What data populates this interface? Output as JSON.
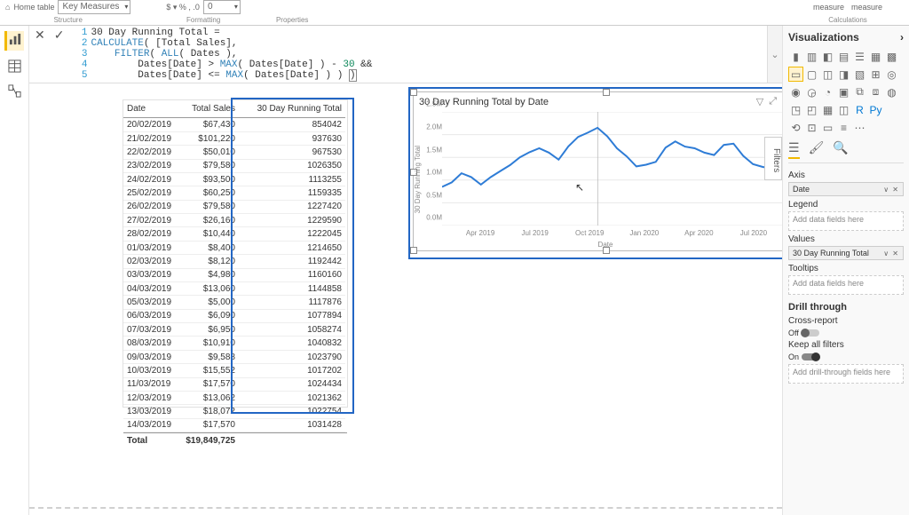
{
  "ribbon": {
    "home_table_label": "Home table",
    "home_table_value": "Key Measures",
    "structure_label": "Structure",
    "format_symbols": "$ ▾  %  ,  .0",
    "decimal_value": "0",
    "formatting_label": "Formatting",
    "properties_label": "Properties",
    "measure_btn1": "",
    "measure_btn2": "measure",
    "measure_btn3": "measure",
    "calculations_label": "Calculations"
  },
  "formula": {
    "l1": "30 Day Running Total =",
    "l2": "CALCULATE( [Total Sales],",
    "l3": "    FILTER( ALL( Dates ),",
    "l4": "        Dates[Date] > MAX( Dates[Date] ) - 30 &&",
    "l5": "        Dates[Date] <= MAX( Dates[Date] ) ) )"
  },
  "table": {
    "headers": [
      "Date",
      "Total Sales",
      "30 Day Running Total"
    ],
    "rows": [
      [
        "20/02/2019",
        "$67,430",
        "854042"
      ],
      [
        "21/02/2019",
        "$101,220",
        "937630"
      ],
      [
        "22/02/2019",
        "$50,010",
        "967530"
      ],
      [
        "23/02/2019",
        "$79,580",
        "1026350"
      ],
      [
        "24/02/2019",
        "$93,500",
        "1113255"
      ],
      [
        "25/02/2019",
        "$60,250",
        "1159335"
      ],
      [
        "26/02/2019",
        "$79,580",
        "1227420"
      ],
      [
        "27/02/2019",
        "$26,160",
        "1229590"
      ],
      [
        "28/02/2019",
        "$10,440",
        "1222045"
      ],
      [
        "01/03/2019",
        "$8,400",
        "1214650"
      ],
      [
        "02/03/2019",
        "$8,120",
        "1192442"
      ],
      [
        "03/03/2019",
        "$4,980",
        "1160160"
      ],
      [
        "04/03/2019",
        "$13,060",
        "1144858"
      ],
      [
        "05/03/2019",
        "$5,000",
        "1117876"
      ],
      [
        "06/03/2019",
        "$6,090",
        "1077894"
      ],
      [
        "07/03/2019",
        "$6,950",
        "1058274"
      ],
      [
        "08/03/2019",
        "$10,910",
        "1040832"
      ],
      [
        "09/03/2019",
        "$9,588",
        "1023790"
      ],
      [
        "10/03/2019",
        "$15,552",
        "1017202"
      ],
      [
        "11/03/2019",
        "$17,570",
        "1024434"
      ],
      [
        "12/03/2019",
        "$13,062",
        "1021362"
      ],
      [
        "13/03/2019",
        "$18,072",
        "1022754"
      ],
      [
        "14/03/2019",
        "$17,570",
        "1031428"
      ]
    ],
    "total_label": "Total",
    "total_value": "$19,849,725"
  },
  "chart": {
    "title": "30 Day Running Total by Date",
    "y_label": "30 Day Running Total",
    "x_label": "Date",
    "y_ticks": [
      "0.0M",
      "0.5M",
      "1.0M",
      "1.5M",
      "2.0M",
      "2.5M"
    ],
    "x_ticks": [
      "Apr 2019",
      "Jul 2019",
      "Oct 2019",
      "Jan 2020",
      "Apr 2020",
      "Jul 2020"
    ]
  },
  "chart_data": {
    "type": "line",
    "xlabel": "Date",
    "ylabel": "30 Day Running Total",
    "ylim": [
      0,
      2500000
    ],
    "x": [
      "Feb 2019",
      "Mar 2019",
      "Apr 2019",
      "May 2019",
      "Jun 2019",
      "Jul 2019",
      "Aug 2019",
      "Sep 2019",
      "Oct 2019",
      "Nov 2019",
      "Dec 2019",
      "Jan 2020",
      "Feb 2020",
      "Mar 2020",
      "Apr 2020",
      "May 2020",
      "Jun 2020",
      "Jul 2020",
      "Aug 2020"
    ],
    "values": [
      850000,
      1150000,
      900000,
      1200000,
      1500000,
      1700000,
      1450000,
      1950000,
      2150000,
      1700000,
      1300000,
      1400000,
      1850000,
      1700000,
      1550000,
      1800000,
      1350000,
      1250000,
      950000
    ]
  },
  "viz": {
    "title": "Visualizations",
    "axis_label": "Axis",
    "axis_value": "Date",
    "legend_label": "Legend",
    "legend_placeholder": "Add data fields here",
    "values_label": "Values",
    "values_value": "30 Day Running Total",
    "tooltips_label": "Tooltips",
    "tooltips_placeholder": "Add data fields here",
    "drill_title": "Drill through",
    "cross_report": "Cross-report",
    "off": "Off",
    "keep_filters": "Keep all filters",
    "on": "On",
    "drill_placeholder": "Add drill-through fields here"
  },
  "filters_tab": "Filters"
}
